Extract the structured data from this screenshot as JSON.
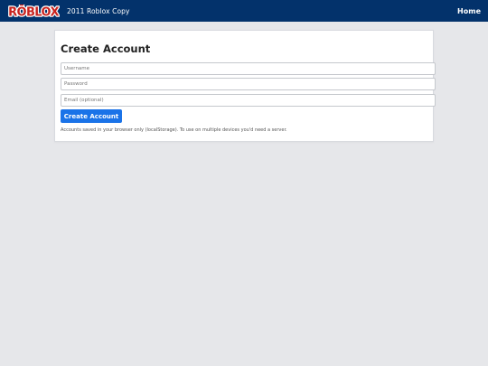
{
  "header": {
    "logo_text": "RŌBLOX",
    "site_title": "2011 Roblox Copy",
    "home_label": "Home"
  },
  "form": {
    "title": "Create Account",
    "username_placeholder": "Username",
    "password_placeholder": "Password",
    "email_placeholder": "Email (optional)",
    "submit_label": "Create Account",
    "note": "Accounts saved in your browser only (localStorage). To use on multiple devices you'd need a server."
  },
  "colors": {
    "header_bg": "#03326b",
    "logo_red": "#c9231f",
    "button_blue": "#1a73e8",
    "page_bg": "#e6e7ea"
  }
}
